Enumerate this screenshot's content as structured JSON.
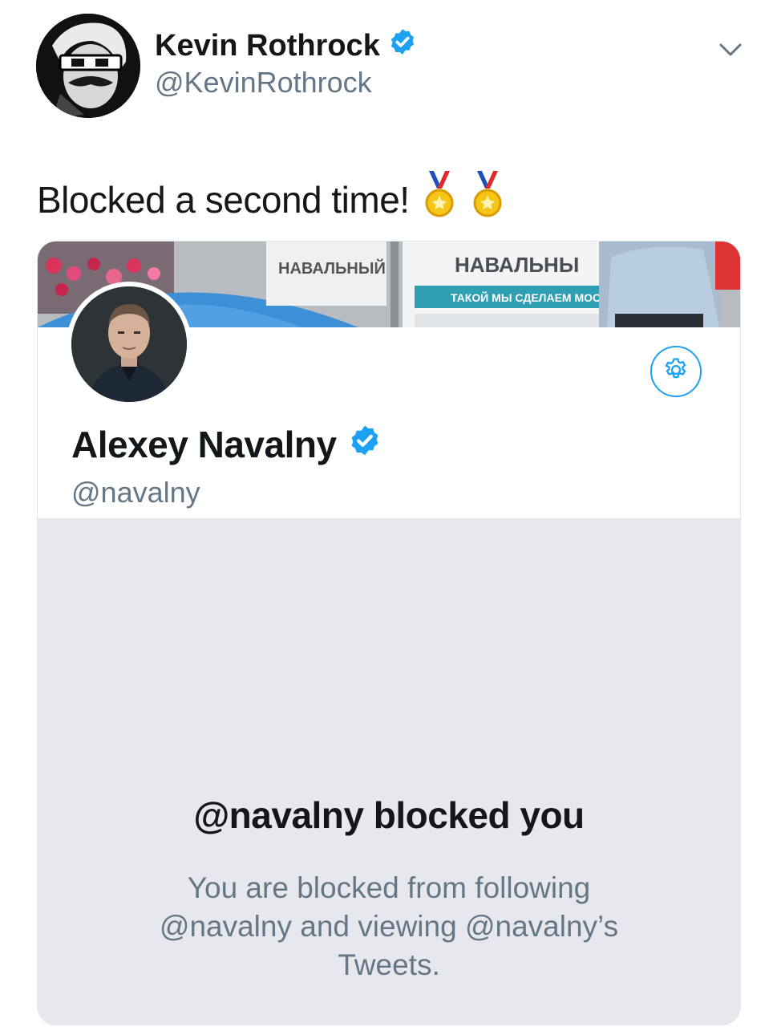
{
  "tweet": {
    "author_name": "Kevin Rothrock",
    "author_handle": "@KevinRothrock",
    "text": "Blocked a second time!",
    "emoji": [
      "🥇",
      "🥇"
    ]
  },
  "embedded_profile": {
    "banner_signs": [
      "НАВАЛЬНЫЙ",
      "НАВАЛЬНЫ",
      "ТАКОЙ МЫ СДЕЛАЕМ МОСК"
    ],
    "name": "Alexey Navalny",
    "handle": "@navalny",
    "blocked_title": "@navalny blocked you",
    "blocked_message": "You are blocked from following @navalny and viewing @navalny’s Tweets."
  },
  "icons": {
    "verified": "verified-badge-icon",
    "menu": "chevron-down-icon",
    "settings": "gear-icon",
    "medal": "medal-icon"
  },
  "colors": {
    "brand_blue": "#1da1f2",
    "text_primary": "#14171a",
    "text_secondary": "#657786",
    "blocked_bg": "#e6e8ee"
  }
}
